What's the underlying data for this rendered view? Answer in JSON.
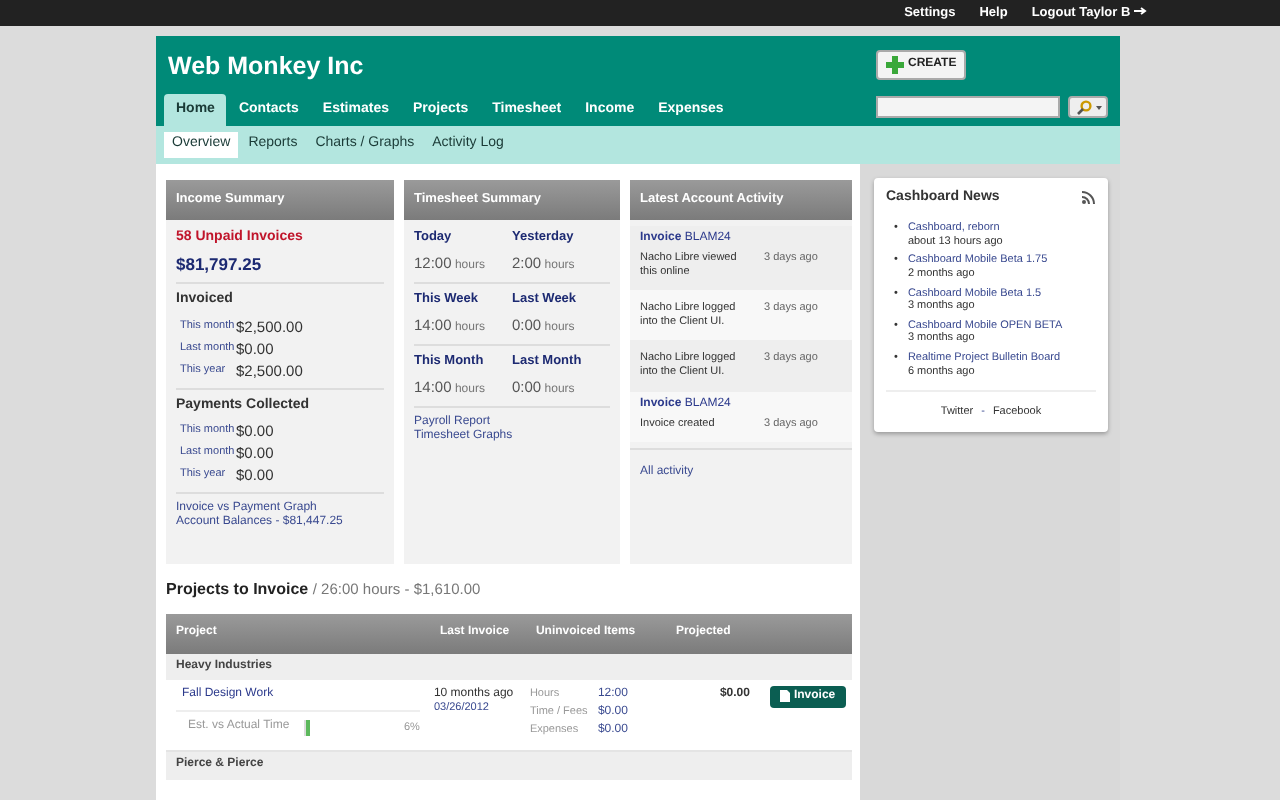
{
  "top_bar": {
    "links": [
      {
        "label": "Settings"
      },
      {
        "label": "Help"
      },
      {
        "label": "Logout Taylor B"
      }
    ]
  },
  "header": {
    "title": "Web Monkey Inc",
    "create_button": "CREATE"
  },
  "tabs": [
    {
      "label": "Home",
      "selected": true
    },
    {
      "label": "Contacts",
      "selected": false
    },
    {
      "label": "Estimates",
      "selected": false
    },
    {
      "label": "Projects",
      "selected": false
    },
    {
      "label": "Timesheet",
      "selected": false
    },
    {
      "label": "Income",
      "selected": false
    },
    {
      "label": "Expenses",
      "selected": false
    }
  ],
  "subtabs": [
    {
      "label": "Overview",
      "selected": true
    },
    {
      "label": "Reports",
      "selected": false
    },
    {
      "label": "Charts / Graphs",
      "selected": false
    },
    {
      "label": "Activity Log",
      "selected": false
    }
  ],
  "income_summary": {
    "title": "Income Summary",
    "unpaid": "58 Unpaid Invoices",
    "total": "$81,797.25",
    "sections": [
      {
        "heading": "Invoiced",
        "rows": [
          {
            "label": "This month",
            "value": "$2,500.00"
          },
          {
            "label": "Last month",
            "value": "$0.00"
          },
          {
            "label": "This year",
            "value": "$2,500.00"
          }
        ]
      },
      {
        "heading": "Payments Collected",
        "rows": [
          {
            "label": "This month",
            "value": "$0.00"
          },
          {
            "label": "Last month",
            "value": "$0.00"
          },
          {
            "label": "This year",
            "value": "$0.00"
          }
        ]
      }
    ],
    "links": [
      "Invoice vs Payment Graph",
      "Account Balances - $81,447.25"
    ]
  },
  "timesheet_summary": {
    "title": "Timesheet Summary",
    "groups": [
      [
        {
          "label": "Today",
          "hours": "12:00",
          "unit": "hours"
        },
        {
          "label": "Yesterday",
          "hours": "2:00",
          "unit": "hours"
        }
      ],
      [
        {
          "label": "This Week",
          "hours": "14:00",
          "unit": "hours"
        },
        {
          "label": "Last Week",
          "hours": "0:00",
          "unit": "hours"
        }
      ],
      [
        {
          "label": "This Month",
          "hours": "14:00",
          "unit": "hours"
        },
        {
          "label": "Last Month",
          "hours": "0:00",
          "unit": "hours"
        }
      ]
    ],
    "links": [
      "Payroll Report",
      "Timesheet Graphs"
    ]
  },
  "activity": {
    "title": "Latest Account Activity",
    "items": [
      {
        "link": "**Invoice** BLAM24",
        "text": "Nacho Libre viewed this online",
        "time": "3 days ago"
      },
      {
        "text": "Nacho Libre logged into the Client UI.",
        "time": "3 days ago"
      },
      {
        "text": "Nacho Libre logged into the Client UI.",
        "time": "3 days ago"
      },
      {
        "link": "**Invoice** BLAM24",
        "text": "Invoice created",
        "time": "3 days ago"
      }
    ],
    "all_link": "All activity"
  },
  "news": {
    "title": "Cashboard News",
    "items": [
      {
        "title": "Cashboard, reborn",
        "time": "about 13 hours ago"
      },
      {
        "title": "Cashboard Mobile Beta 1.75",
        "time": "2 months ago"
      },
      {
        "title": "Cashboard Mobile Beta 1.5",
        "time": "3 months ago"
      },
      {
        "title": "Cashboard Mobile OPEN BETA",
        "time": "3 months ago"
      },
      {
        "title": "Realtime Project Bulletin Board",
        "time": "6 months ago"
      }
    ],
    "bullet": "•",
    "footer_links": [
      "Twitter",
      "Facebook"
    ],
    "separator": "-"
  },
  "projects": {
    "heading": "Projects to Invoice",
    "summary": "/ 26:00 hours - $1,610.00",
    "columns": [
      "Project",
      "Last Invoice",
      "Uninvoiced Items",
      "Projected"
    ],
    "groups": [
      {
        "name": "Heavy Industries",
        "projects": [
          {
            "name": "Fall Design Work",
            "last_invoice": "10 months ago",
            "date": "03/26/2012",
            "est_label": "Est. vs Actual Time",
            "level": 0.06,
            "percent": "6%",
            "items": [
              {
                "label": "Hours",
                "value": "12:00"
              },
              {
                "label": "Time / Fees",
                "value": "$0.00"
              },
              {
                "label": "Expenses",
                "value": "$0.00"
              }
            ],
            "projected": "$0.00",
            "button": "Invoice"
          }
        ]
      },
      {
        "name": "Pierce & Pierce"
      }
    ]
  }
}
